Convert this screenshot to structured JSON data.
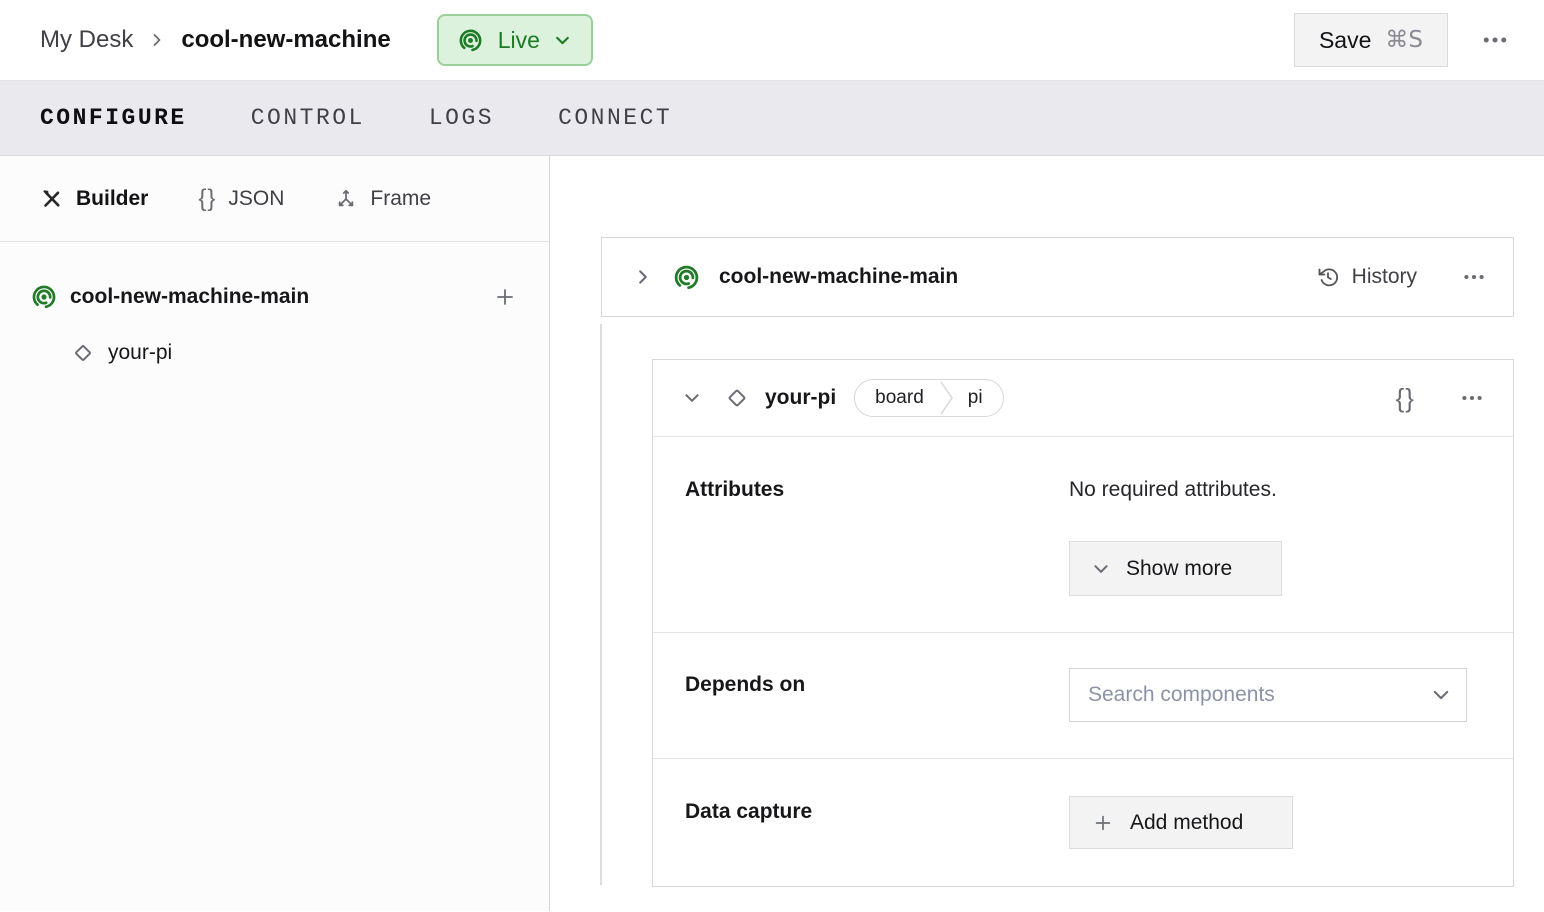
{
  "header": {
    "breadcrumb": {
      "parent": "My Desk",
      "current": "cool-new-machine"
    },
    "live_badge": {
      "label": "Live",
      "icon": "broadcast-icon"
    },
    "save": {
      "label": "Save",
      "shortcut": "⌘S"
    },
    "more_menu_icon": "ellipsis-icon"
  },
  "nav_tabs": [
    {
      "label": "CONFIGURE",
      "active": true
    },
    {
      "label": "CONTROL",
      "active": false
    },
    {
      "label": "LOGS",
      "active": false
    },
    {
      "label": "CONNECT",
      "active": false
    }
  ],
  "sidebar": {
    "view_tabs": [
      {
        "label": "Builder",
        "icon": "wrench-screwdriver-icon",
        "active": true
      },
      {
        "label": "JSON",
        "icon": "curly-braces-icon",
        "active": false
      },
      {
        "label": "Frame",
        "icon": "frame-axes-icon",
        "active": false
      }
    ],
    "tree": [
      {
        "label": "cool-new-machine-main",
        "icon": "machine-part-icon",
        "action_icon": "plus-icon"
      },
      {
        "label": "your-pi",
        "icon": "component-diamond-icon"
      }
    ]
  },
  "main": {
    "machine_card": {
      "title": "cool-new-machine-main",
      "history_label": "History",
      "icons": [
        "chevron-right-icon",
        "machine-part-icon",
        "history-icon",
        "ellipsis-icon"
      ]
    },
    "component_card": {
      "title": "your-pi",
      "badge": {
        "type": "board",
        "model": "pi"
      },
      "attributes": {
        "label": "Attributes",
        "empty_message": "No required attributes.",
        "show_more_label": "Show more"
      },
      "depends_on": {
        "label": "Depends on",
        "search_placeholder": "Search components"
      },
      "data_capture": {
        "label": "Data capture",
        "add_method_label": "Add method"
      },
      "icons": [
        "chevron-down-icon",
        "component-diamond-icon",
        "curly-braces-icon",
        "ellipsis-icon"
      ]
    }
  },
  "icons": {
    "braces_glyph": "{}"
  },
  "colors": {
    "accent_green": "#237a29",
    "live_badge_bg": "#dcf2dc",
    "live_badge_border": "#98d098",
    "tabbar_bg": "#eaeaee",
    "button_bg": "#f3f3f4",
    "card_border": "#d6d6db",
    "placeholder": "#8b93a5"
  }
}
